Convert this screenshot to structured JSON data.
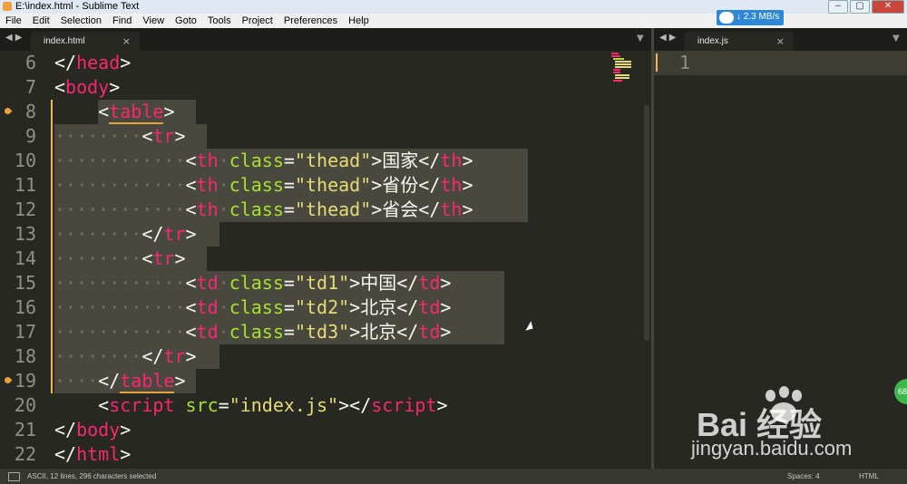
{
  "window": {
    "title": "E:\\index.html - Sublime Text",
    "min": "–",
    "max": "▢",
    "close": "✕"
  },
  "menu": [
    "File",
    "Edit",
    "Selection",
    "Find",
    "View",
    "Goto",
    "Tools",
    "Project",
    "Preferences",
    "Help"
  ],
  "netspeed": {
    "text": "↓ 2.3 MB/s"
  },
  "tabs": {
    "left": {
      "label": "index.html",
      "close": "×"
    },
    "right": {
      "label": "index.js",
      "close": "×"
    }
  },
  "editor": {
    "lines": [
      {
        "n": "6",
        "parts": [
          [
            "tag-br",
            "</"
          ],
          [
            "tag",
            "head"
          ],
          [
            "tag-br",
            ">"
          ]
        ]
      },
      {
        "n": "7",
        "parts": [
          [
            "tag-br",
            "<"
          ],
          [
            "tag",
            "body"
          ],
          [
            "tag-br",
            ">"
          ]
        ]
      },
      {
        "n": "8",
        "parts": [
          [
            "plain",
            "    "
          ],
          [
            "tag-br",
            "<"
          ],
          [
            "tagu",
            "table"
          ],
          [
            "tag-br",
            ">"
          ]
        ],
        "bookmark": true,
        "sel": [
          [
            108,
            216
          ]
        ]
      },
      {
        "n": "9",
        "parts": [
          [
            "dots",
            "········"
          ],
          [
            "tag-br",
            "<"
          ],
          [
            "tag",
            "tr"
          ],
          [
            "tag-br",
            ">"
          ]
        ],
        "sel": [
          [
            60,
            228
          ]
        ]
      },
      {
        "n": "10",
        "parts": [
          [
            "dots",
            "············"
          ],
          [
            "tag-br",
            "<"
          ],
          [
            "tag",
            "th"
          ],
          [
            "dots",
            "·"
          ],
          [
            "attr",
            "class"
          ],
          [
            "plain",
            "="
          ],
          [
            "str",
            "\"thead\""
          ],
          [
            "plain",
            ">国家</"
          ],
          [
            "tag",
            "th"
          ],
          [
            "plain",
            ">"
          ]
        ],
        "sel": [
          [
            60,
            582
          ]
        ]
      },
      {
        "n": "11",
        "parts": [
          [
            "dots",
            "············"
          ],
          [
            "tag-br",
            "<"
          ],
          [
            "tag",
            "th"
          ],
          [
            "dots",
            "·"
          ],
          [
            "attr",
            "class"
          ],
          [
            "plain",
            "="
          ],
          [
            "str",
            "\"thead\""
          ],
          [
            "plain",
            ">省份</"
          ],
          [
            "tag",
            "th"
          ],
          [
            "plain",
            ">"
          ]
        ],
        "sel": [
          [
            60,
            582
          ]
        ]
      },
      {
        "n": "12",
        "parts": [
          [
            "dots",
            "············"
          ],
          [
            "tag-br",
            "<"
          ],
          [
            "tag",
            "th"
          ],
          [
            "dots",
            "·"
          ],
          [
            "attr",
            "class"
          ],
          [
            "plain",
            "="
          ],
          [
            "str",
            "\"thead\""
          ],
          [
            "plain",
            ">省会</"
          ],
          [
            "tag",
            "th"
          ],
          [
            "plain",
            ">"
          ]
        ],
        "sel": [
          [
            60,
            582
          ]
        ]
      },
      {
        "n": "13",
        "parts": [
          [
            "dots",
            "········"
          ],
          [
            "tag-br",
            "</"
          ],
          [
            "tag",
            "tr"
          ],
          [
            "tag-br",
            ">"
          ]
        ],
        "sel": [
          [
            60,
            242
          ]
        ]
      },
      {
        "n": "14",
        "parts": [
          [
            "dots",
            "········"
          ],
          [
            "tag-br",
            "<"
          ],
          [
            "tag",
            "tr"
          ],
          [
            "tag-br",
            ">"
          ]
        ],
        "sel": [
          [
            60,
            228
          ]
        ]
      },
      {
        "n": "15",
        "parts": [
          [
            "dots",
            "············"
          ],
          [
            "tag-br",
            "<"
          ],
          [
            "tag",
            "td"
          ],
          [
            "dots",
            "·"
          ],
          [
            "attr",
            "class"
          ],
          [
            "plain",
            "="
          ],
          [
            "str",
            "\"td1\""
          ],
          [
            "plain",
            ">中国</"
          ],
          [
            "tag",
            "td"
          ],
          [
            "plain",
            ">"
          ]
        ],
        "sel": [
          [
            60,
            556
          ]
        ]
      },
      {
        "n": "16",
        "parts": [
          [
            "dots",
            "············"
          ],
          [
            "tag-br",
            "<"
          ],
          [
            "tag",
            "td"
          ],
          [
            "dots",
            "·"
          ],
          [
            "attr",
            "class"
          ],
          [
            "plain",
            "="
          ],
          [
            "str",
            "\"td2\""
          ],
          [
            "plain",
            ">北京</"
          ],
          [
            "tag",
            "td"
          ],
          [
            "plain",
            ">"
          ]
        ],
        "sel": [
          [
            60,
            556
          ]
        ]
      },
      {
        "n": "17",
        "parts": [
          [
            "dots",
            "············"
          ],
          [
            "tag-br",
            "<"
          ],
          [
            "tag",
            "td"
          ],
          [
            "dots",
            "·"
          ],
          [
            "attr",
            "class"
          ],
          [
            "plain",
            "="
          ],
          [
            "str",
            "\"td3\""
          ],
          [
            "plain",
            ">北京</"
          ],
          [
            "tag",
            "td"
          ],
          [
            "plain",
            ">"
          ]
        ],
        "sel": [
          [
            60,
            556
          ]
        ]
      },
      {
        "n": "18",
        "parts": [
          [
            "dots",
            "········"
          ],
          [
            "tag-br",
            "</"
          ],
          [
            "tag",
            "tr"
          ],
          [
            "tag-br",
            ">"
          ]
        ],
        "sel": [
          [
            60,
            242
          ]
        ]
      },
      {
        "n": "19",
        "parts": [
          [
            "dots",
            "····"
          ],
          [
            "tag-br",
            "</"
          ],
          [
            "tagu",
            "table"
          ],
          [
            "tag-br",
            ">"
          ]
        ],
        "bookmark": true,
        "sel": [
          [
            60,
            216
          ]
        ]
      },
      {
        "n": "20",
        "parts": [
          [
            "plain",
            "    "
          ],
          [
            "tag-br",
            "<"
          ],
          [
            "tag",
            "script"
          ],
          [
            "plain",
            " "
          ],
          [
            "attr",
            "src"
          ],
          [
            "plain",
            "="
          ],
          [
            "str",
            "\"index.js\""
          ],
          [
            "plain",
            "></"
          ],
          [
            "tag",
            "script"
          ],
          [
            "plain",
            ">"
          ]
        ]
      },
      {
        "n": "21",
        "parts": [
          [
            "tag-br",
            "</"
          ],
          [
            "tag",
            "body"
          ],
          [
            "tag-br",
            ">"
          ]
        ]
      },
      {
        "n": "22",
        "parts": [
          [
            "tag-br",
            "</"
          ],
          [
            "tag",
            "html"
          ],
          [
            "tag-br",
            ">"
          ]
        ]
      }
    ]
  },
  "right_editor": {
    "line_number": "1"
  },
  "statusbar": {
    "info": "ASCII, 12 lines, 296 characters selected",
    "spaces": "Spaces: 4",
    "syntax": "HTML"
  },
  "watermark": {
    "brand": "Bai  经验",
    "url": "jingyan.baidu.com"
  },
  "side_badge": "68",
  "colors": {
    "background": "#272822",
    "tag": "#f92672",
    "attr": "#a6e22e",
    "string": "#e6db74",
    "selection": "#49483e"
  }
}
